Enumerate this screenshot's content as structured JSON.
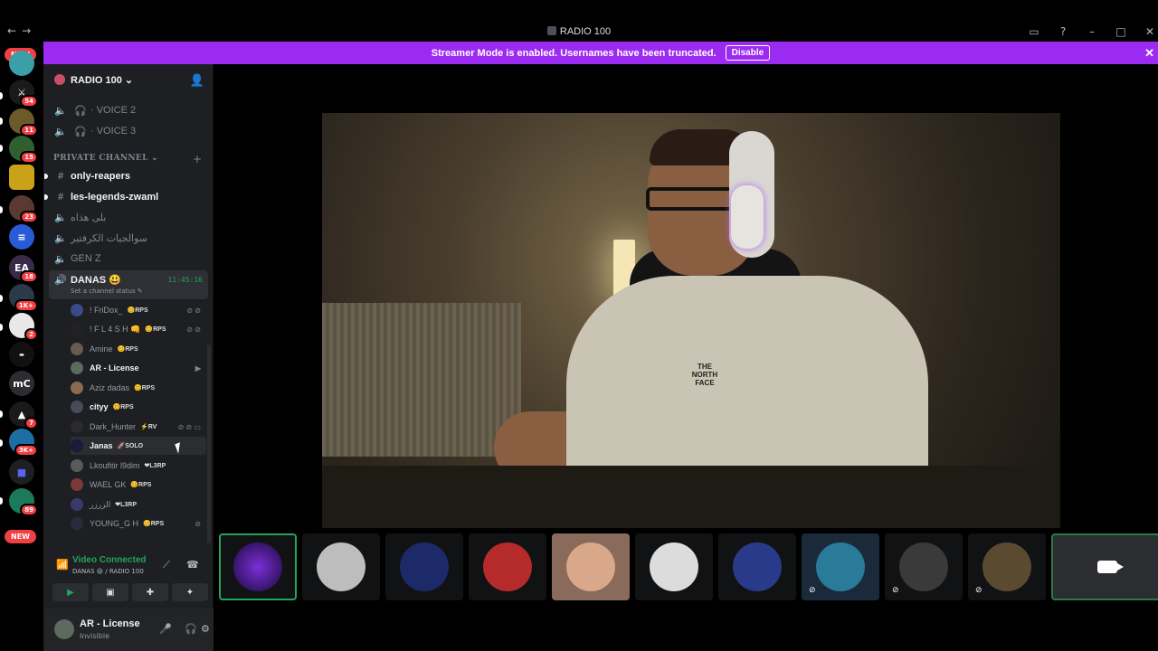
{
  "window": {
    "title": "RADIO 100",
    "nav_back": "←",
    "nav_forward": "→",
    "icons": [
      "inbox-icon",
      "help-icon",
      "minimize-icon",
      "maximize-icon",
      "close-icon"
    ]
  },
  "banner": {
    "text": "Streamer Mode is enabled. Usernames have been truncated.",
    "button": "Disable",
    "close": "✕",
    "color": "#9b2bf1"
  },
  "guilds": {
    "new_top": "NEW",
    "new_bottom": "NEW",
    "items": [
      {
        "badge": "",
        "label": ""
      },
      {
        "badge": "54",
        "label": ""
      },
      {
        "badge": "11",
        "label": ""
      },
      {
        "badge": "15",
        "label": ""
      },
      {
        "badge": "",
        "label": ""
      },
      {
        "badge": "23",
        "label": ""
      },
      {
        "badge": "",
        "label": ""
      },
      {
        "badge": "18",
        "label": "EA"
      },
      {
        "badge": "1K+",
        "label": ""
      },
      {
        "badge": "2",
        "label": ""
      },
      {
        "badge": "",
        "label": ""
      },
      {
        "badge": "",
        "label": "mC"
      },
      {
        "badge": "7",
        "label": ""
      },
      {
        "badge": "3K+",
        "label": ""
      },
      {
        "badge": "",
        "label": ""
      },
      {
        "badge": "89",
        "label": ""
      }
    ]
  },
  "server": {
    "name": "RADIO 100 ⌄",
    "voice_channels": [
      {
        "name": "· VOICE 2"
      },
      {
        "name": "· VOICE 3"
      }
    ],
    "category": "PRIVATE CHANNEL ⌄",
    "category_plus": "+",
    "text_channels": [
      {
        "name": "only-reapers",
        "icon": "#"
      },
      {
        "name": "les-legends-zwaml",
        "icon": "#"
      },
      {
        "name": "بلى هذاه",
        "icon": "🔊"
      },
      {
        "name": "سوالجيات الكرفتير",
        "icon": "🔊"
      },
      {
        "name": "GEN Z",
        "icon": "🔊"
      }
    ],
    "active_voice": {
      "name": "DANAS 😃",
      "status": "Set a channel status ✎",
      "timer": "11:45:16"
    },
    "members": [
      {
        "name": "! FriDox_",
        "tag": "😊RPS",
        "icons": "⊘ ⊘"
      },
      {
        "name": "! F L 4 S H 👊",
        "tag": "😊RPS",
        "icons": "⊘ ⊘"
      },
      {
        "name": "Amine",
        "tag": "😊RPS",
        "icons": ""
      },
      {
        "name": "AR - License",
        "tag": "",
        "icons": "▶"
      },
      {
        "name": "Aziz dadas",
        "tag": "😊RPS",
        "icons": ""
      },
      {
        "name": "cityy",
        "tag": "😊RPS",
        "icons": ""
      },
      {
        "name": "Dark_Hunter",
        "tag": "⚡RV",
        "icons": "⊘ ⊘ ▭"
      },
      {
        "name": "Janas",
        "tag": "🚀SOLO",
        "icons": ""
      },
      {
        "name": "Lkoufitir l9dim",
        "tag": "❤L3RP",
        "icons": ""
      },
      {
        "name": "WAEL GK",
        "tag": "😊RPS",
        "icons": ""
      },
      {
        "name": "الزرزر",
        "tag": "❤L3RP",
        "icons": ""
      },
      {
        "name": "YOUNG_G H",
        "tag": "😊RPS",
        "icons": "⊘"
      }
    ]
  },
  "voice_panel": {
    "status": "Video Connected",
    "sub": "DANAS 😃 / RADIO 100"
  },
  "user": {
    "name": "AR - License",
    "status": "Invisible"
  },
  "video": {
    "shirt_text": "THE\nNORTH\nFACE"
  },
  "tiles": {
    "count": 11,
    "selected": 0,
    "last": "camera"
  }
}
